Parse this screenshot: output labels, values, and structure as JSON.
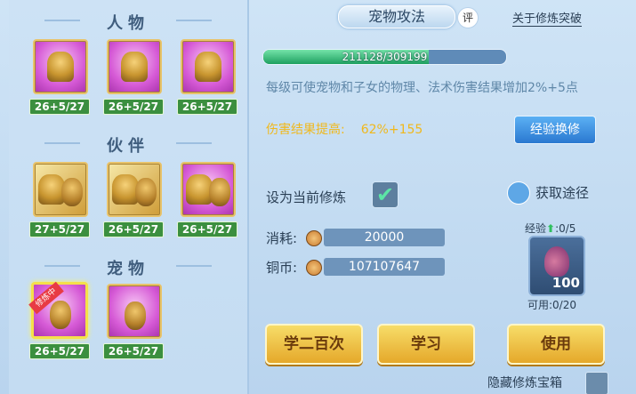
{
  "left_panel": {
    "sections": [
      {
        "title": "人物",
        "icons": [
          {
            "icon": "golden-figure-icon",
            "level": "26+5/27",
            "highlight": "pink"
          },
          {
            "icon": "golden-armor-icon",
            "level": "26+5/27",
            "highlight": "pink"
          },
          {
            "icon": "golden-warrior-icon",
            "level": "26+5/27",
            "highlight": "pink"
          }
        ]
      },
      {
        "title": "伙伴",
        "icons": [
          {
            "icon": "lion-sword-icon",
            "level": "27+5/27",
            "highlight": "gold"
          },
          {
            "icon": "lion-shield-icon",
            "level": "26+5/27",
            "highlight": "gold"
          },
          {
            "icon": "lion-armor-icon",
            "level": "26+5/27",
            "highlight": "pink"
          }
        ]
      },
      {
        "title": "宠物",
        "icons": [
          {
            "icon": "cat-fan-icon",
            "level": "26+5/27",
            "highlight": "pink",
            "selected": true,
            "ribbon": "修炼中"
          },
          {
            "icon": "cat-shield-icon",
            "level": "26+5/27",
            "highlight": "pink"
          }
        ]
      }
    ]
  },
  "right_panel": {
    "title": "宠物攻法",
    "rate_badge": "评",
    "about_link": "关于修炼突破",
    "progress": {
      "text": "211128/309199",
      "value": 211128,
      "max": 309199
    },
    "description": "每级可使宠物和子女的物理、法术伤害结果增加2%+5点",
    "damage_label": "伤害结果提高:",
    "damage_value": "62%+155",
    "exp_swap_button": "经验换修",
    "set_current_label": "设为当前修炼",
    "set_current_checked": true,
    "obtain_label": "获取途径",
    "cost_label": "消耗:",
    "cost_value": "20000",
    "coins_label": "铜币:",
    "coins_value": "107107647",
    "exp_label": "经验",
    "exp_value": ":0/5",
    "item_count": "100",
    "usable_label": "可用:0/20",
    "buttons": {
      "learn200": "学二百次",
      "learn": "学习",
      "use": "使用"
    },
    "hide_label": "隐藏修炼宝箱"
  },
  "colors": {
    "panel_bg": "#c4dcf2",
    "level_badge": "#3b8f3f",
    "damage_text": "#f0b81c",
    "button_gold": "#f0c445",
    "button_blue": "#3b8ee0"
  }
}
